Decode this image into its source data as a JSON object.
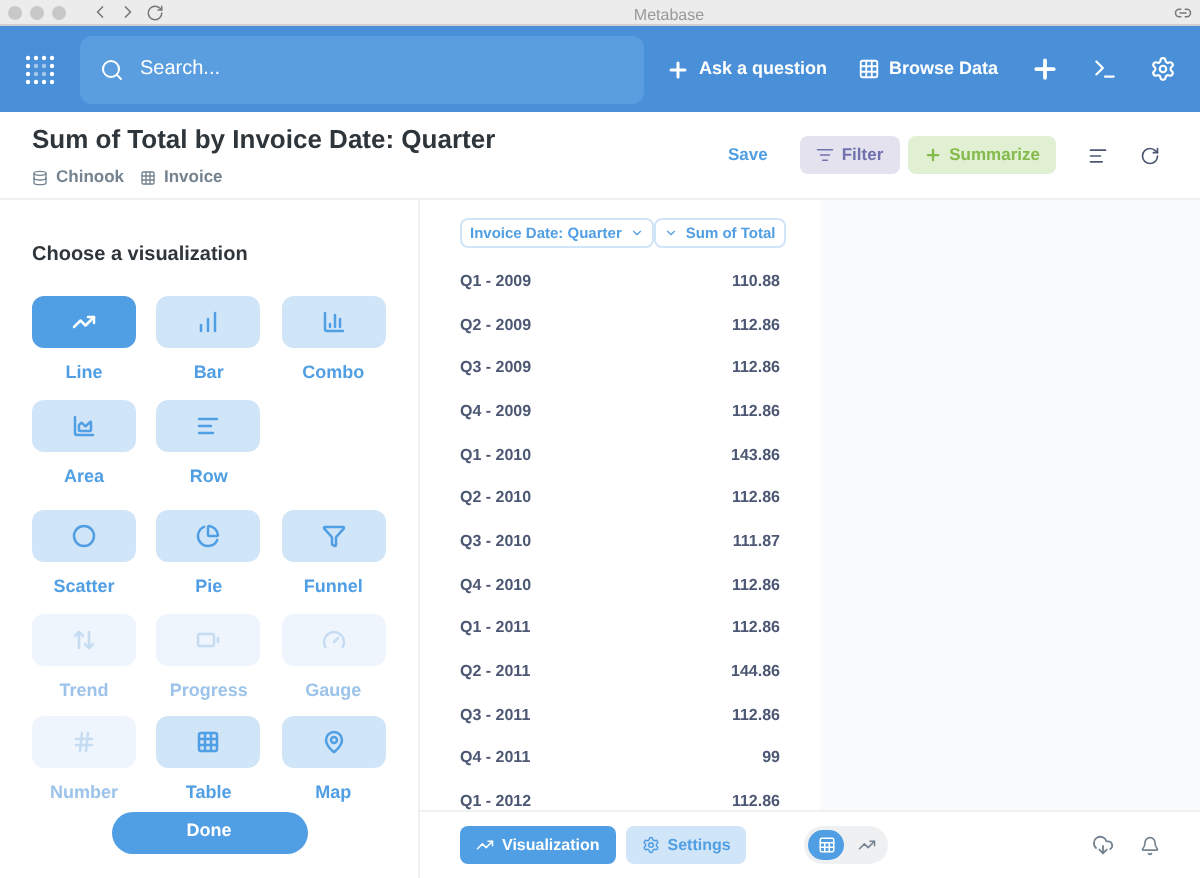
{
  "window": {
    "title": "Metabase"
  },
  "nav": {
    "search_placeholder": "Search...",
    "ask": "Ask a question",
    "browse": "Browse Data"
  },
  "question": {
    "title": "Sum of Total by Invoice Date: Quarter",
    "database": "Chinook",
    "table": "Invoice",
    "save": "Save",
    "filter": "Filter",
    "summarize": "Summarize"
  },
  "viz_panel": {
    "heading": "Choose a visualization",
    "done": "Done",
    "groups": [
      [
        {
          "label": "Line",
          "kind": "line",
          "selected": true,
          "disabled": false
        },
        {
          "label": "Bar",
          "kind": "bar",
          "selected": false,
          "disabled": false
        },
        {
          "label": "Combo",
          "kind": "combo",
          "selected": false,
          "disabled": false
        },
        {
          "label": "Area",
          "kind": "area",
          "selected": false,
          "disabled": false
        },
        {
          "label": "Row",
          "kind": "row",
          "selected": false,
          "disabled": false
        }
      ],
      [
        {
          "label": "Scatter",
          "kind": "scatter",
          "selected": false,
          "disabled": false
        },
        {
          "label": "Pie",
          "kind": "pie",
          "selected": false,
          "disabled": false
        },
        {
          "label": "Funnel",
          "kind": "funnel",
          "selected": false,
          "disabled": false
        },
        {
          "label": "Trend",
          "kind": "trend",
          "selected": false,
          "disabled": true
        },
        {
          "label": "Progress",
          "kind": "progress",
          "selected": false,
          "disabled": true
        },
        {
          "label": "Gauge",
          "kind": "gauge",
          "selected": false,
          "disabled": true
        },
        {
          "label": "Number",
          "kind": "number",
          "selected": false,
          "disabled": true
        },
        {
          "label": "Table",
          "kind": "table",
          "selected": false,
          "disabled": false
        },
        {
          "label": "Map",
          "kind": "map",
          "selected": false,
          "disabled": false
        }
      ]
    ]
  },
  "table": {
    "columns": [
      "Invoice Date: Quarter",
      "Sum of Total"
    ],
    "rows": [
      [
        "Q1 - 2009",
        "110.88"
      ],
      [
        "Q2 - 2009",
        "112.86"
      ],
      [
        "Q3 - 2009",
        "112.86"
      ],
      [
        "Q4 - 2009",
        "112.86"
      ],
      [
        "Q1 - 2010",
        "143.86"
      ],
      [
        "Q2 - 2010",
        "112.86"
      ],
      [
        "Q3 - 2010",
        "111.87"
      ],
      [
        "Q4 - 2010",
        "112.86"
      ],
      [
        "Q1 - 2011",
        "112.86"
      ],
      [
        "Q2 - 2011",
        "144.86"
      ],
      [
        "Q3 - 2011",
        "112.86"
      ],
      [
        "Q4 - 2011",
        "99"
      ],
      [
        "Q1 - 2012",
        "112.86"
      ]
    ]
  },
  "footer": {
    "visualization": "Visualization",
    "settings": "Settings",
    "view_toggle": [
      {
        "kind": "table",
        "selected": true
      },
      {
        "kind": "chart",
        "selected": false
      }
    ]
  }
}
